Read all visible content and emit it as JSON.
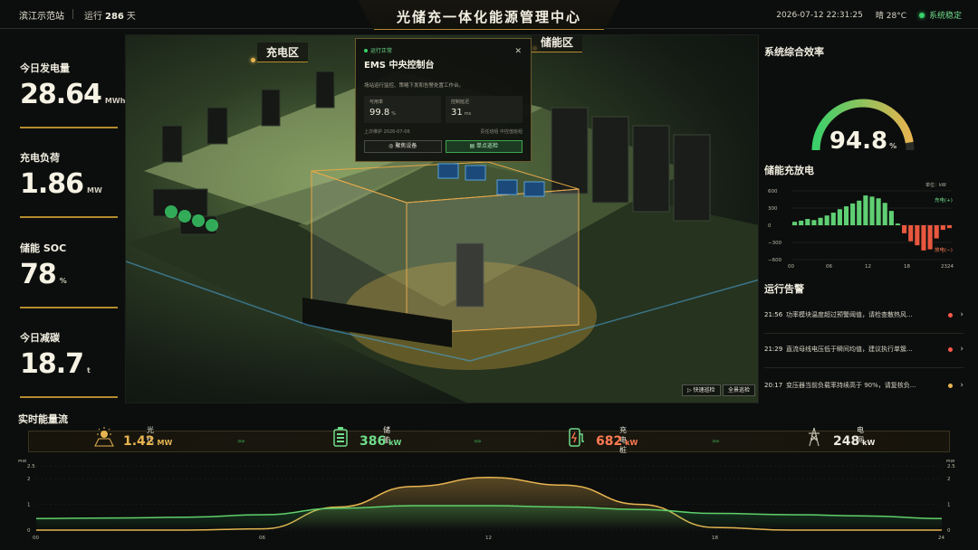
{
  "header": {
    "site": "滨江示范站",
    "uptime_label": "运行",
    "uptime_days": "286",
    "uptime_unit": "天",
    "title": "光储充一体化能源管理中心",
    "datetime": "2026-07-12 22:31:25",
    "weather": "晴 28°C",
    "status": "系统稳定"
  },
  "kpis": [
    {
      "label": "今日发电量",
      "value": "28.64",
      "unit": "MWh"
    },
    {
      "label": "充电负荷",
      "value": "1.86",
      "unit": "MW"
    },
    {
      "label": "储能 SOC",
      "value": "78",
      "unit": "%"
    },
    {
      "label": "今日减碳",
      "value": "18.7",
      "unit": "t"
    }
  ],
  "scene": {
    "zone_charge": "充电区",
    "zone_storage": "储能区",
    "popup": {
      "status": "运行正常",
      "title": "EMS 中央控制台",
      "desc": "场站运行监控、策略下发和告警处置工作台。",
      "metric1_label": "可用率",
      "metric1_value": "99.8",
      "metric1_unit": "%",
      "metric2_label": "控制延迟",
      "metric2_value": "31",
      "metric2_unit": "ms",
      "maint": "上次维护 2026-07-06",
      "owner": "责任班组 中控值班组",
      "btn_focus": "聚焦设备",
      "btn_patrol": "单点巡检"
    },
    "btn_quick": "快速巡检",
    "btn_all": "全景巡检"
  },
  "efficiency": {
    "title": "系统综合效率",
    "value": "94.8",
    "unit": "%",
    "fraction": 0.948
  },
  "storage": {
    "title": "储能充放电",
    "unit_label": "单位：kW",
    "legend_charge": "充电(+)",
    "legend_discharge": "放电(−)",
    "yticks": [
      "600",
      "300",
      "0",
      "−300",
      "−600"
    ],
    "xticks": [
      "00",
      "06",
      "12",
      "18",
      "2324"
    ]
  },
  "alarms": {
    "title": "运行告警",
    "items": [
      {
        "time": "21:56",
        "msg": "功率模块温度超过预警阈值，请检查散热风...",
        "level": "red"
      },
      {
        "time": "21:29",
        "msg": "直流母线电压低于瞬间均值，建议执行单簇...",
        "level": "red"
      },
      {
        "time": "20:17",
        "msg": "变压器当前负载率持续高于 90%，请复核负...",
        "level": "amber"
      }
    ]
  },
  "flow": {
    "title": "实时能量流",
    "items": [
      {
        "name": "光伏",
        "value": "1.42",
        "unit": "MW",
        "color": "#e6b450"
      },
      {
        "name": "储能",
        "value": "386",
        "unit": "kW",
        "color": "#6fdc8a"
      },
      {
        "name": "充电桩",
        "value": "682",
        "unit": "kW",
        "color": "#ff7a52"
      },
      {
        "name": "电网",
        "value": "248",
        "unit": "kW",
        "color": "#e9e6da"
      }
    ]
  },
  "trend": {
    "yunit": "MW",
    "yticks": [
      "2.5",
      "2",
      "1",
      "0"
    ],
    "xticks": [
      "00",
      "06",
      "12",
      "18",
      "24"
    ]
  },
  "chart_data": [
    {
      "type": "bar",
      "title": "储能充放电",
      "ylabel": "kW",
      "ylim": [
        -600,
        600
      ],
      "x": [
        0,
        1,
        2,
        3,
        4,
        5,
        6,
        7,
        8,
        9,
        10,
        11,
        12,
        13,
        14,
        15,
        16,
        17,
        18,
        19,
        20,
        21,
        22,
        23,
        24
      ],
      "series": [
        {
          "name": "充电(+)/放电(−)",
          "values": [
            60,
            80,
            110,
            90,
            130,
            170,
            220,
            280,
            330,
            380,
            430,
            520,
            500,
            470,
            390,
            250,
            30,
            -140,
            -280,
            -350,
            -440,
            -420,
            -230,
            -80,
            -50
          ]
        }
      ]
    },
    {
      "type": "line",
      "ylabel": "MW",
      "ylim": [
        0,
        2.5
      ],
      "x": [
        0,
        2,
        4,
        6,
        8,
        10,
        12,
        14,
        16,
        18,
        20,
        22,
        24
      ],
      "series": [
        {
          "name": "光伏",
          "values": [
            0,
            0,
            0,
            0.05,
            0.9,
            1.7,
            2.05,
            1.75,
            1.0,
            0.1,
            0,
            0,
            0
          ]
        },
        {
          "name": "储能",
          "values": [
            0.45,
            0.47,
            0.5,
            0.6,
            0.85,
            0.95,
            0.95,
            0.9,
            0.8,
            0.65,
            0.6,
            0.55,
            0.45
          ]
        }
      ]
    }
  ]
}
